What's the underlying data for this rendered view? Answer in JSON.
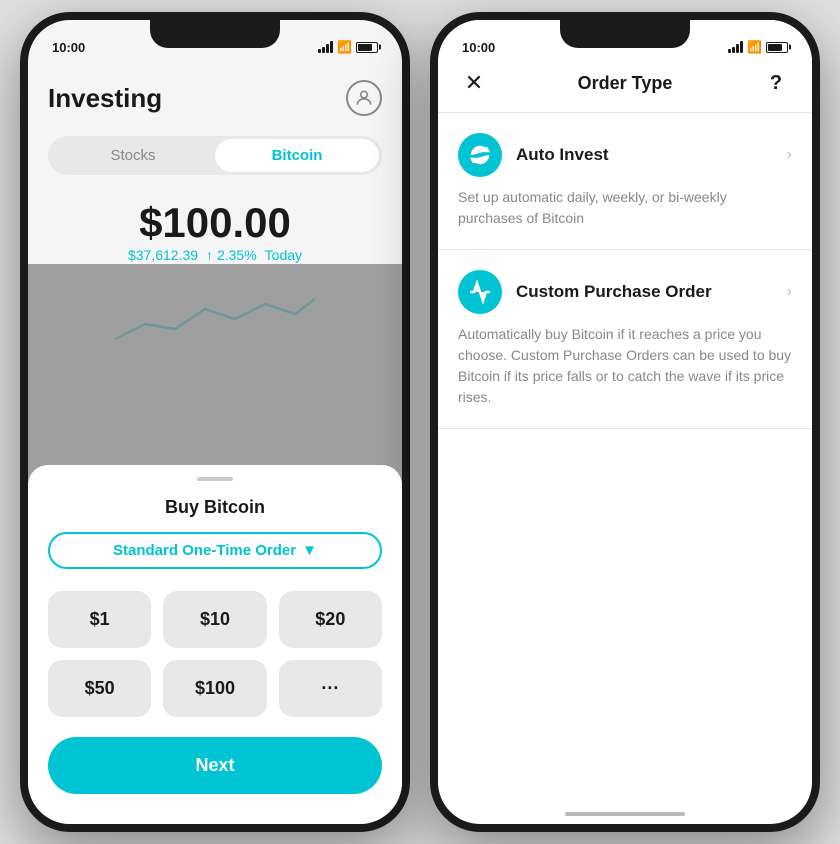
{
  "left_phone": {
    "status_time": "10:00",
    "header": {
      "title": "Investing",
      "avatar_label": "profile"
    },
    "tabs": [
      {
        "label": "Stocks",
        "active": false
      },
      {
        "label": "Bitcoin",
        "active": true
      }
    ],
    "price": {
      "main": "$100.00",
      "sub_price": "$37,612.39",
      "change_percent": "↑ 2.35%",
      "period": "Today"
    },
    "sheet": {
      "title": "Buy Bitcoin",
      "order_type": "Standard One-Time Order",
      "order_type_chevron": "▼",
      "amounts": [
        "$1",
        "$10",
        "$20",
        "$50",
        "$100",
        "···"
      ],
      "next_label": "Next"
    }
  },
  "right_phone": {
    "status_time": "10:00",
    "header": {
      "close_label": "✕",
      "title": "Order Type",
      "help_label": "?"
    },
    "options": [
      {
        "id": "auto-invest",
        "icon_type": "refresh",
        "title": "Auto Invest",
        "description": "Set up automatic daily, weekly, or bi-weekly purchases of Bitcoin"
      },
      {
        "id": "custom-purchase",
        "icon_type": "chart",
        "title": "Custom Purchase Order",
        "description": "Automatically buy Bitcoin if it reaches a price you choose. Custom Purchase Orders can be used to buy Bitcoin if its price falls or to catch the wave if its price rises."
      }
    ]
  }
}
